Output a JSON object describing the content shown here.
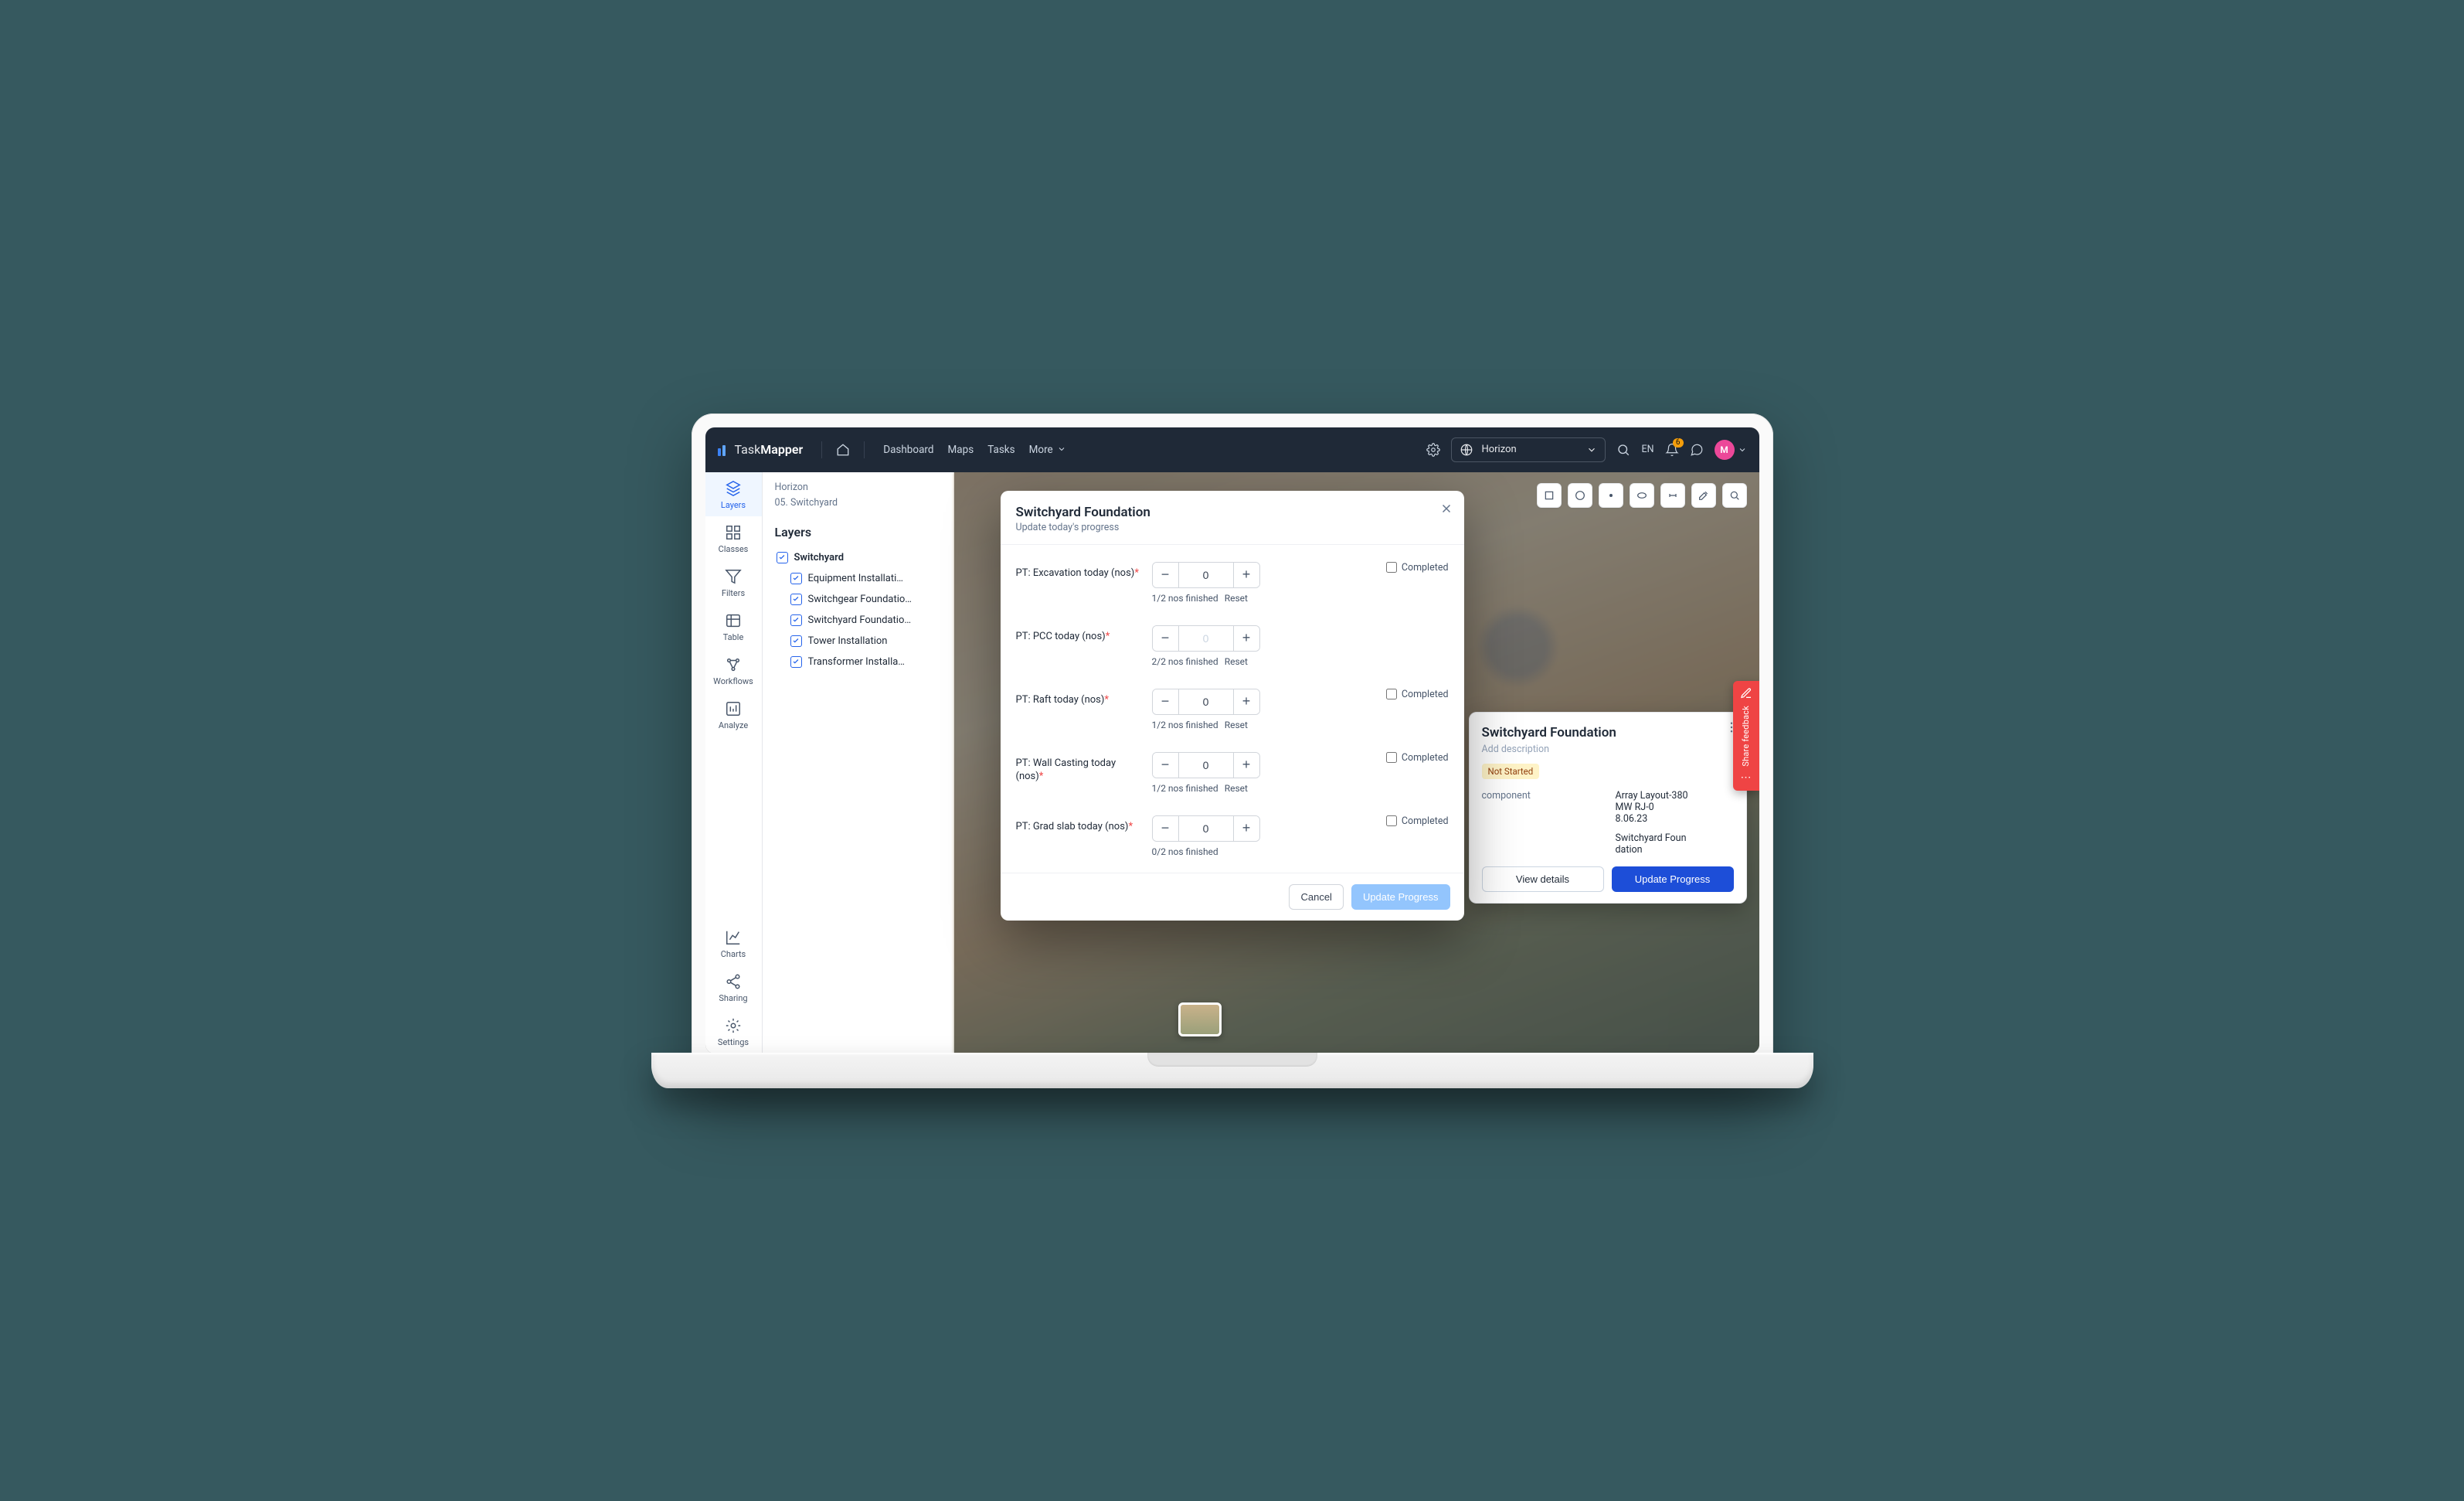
{
  "brand": {
    "name_prefix": "Task",
    "name_suffix": "Mapper"
  },
  "topnav": {
    "items": [
      "Dashboard",
      "Maps",
      "Tasks",
      "More"
    ],
    "asset_selected": "Horizon",
    "lang": "EN",
    "notif_count": "6",
    "avatar_letter": "M"
  },
  "rail": {
    "items_top": [
      "Layers",
      "Classes",
      "Filters",
      "Table",
      "Workflows",
      "Analyze"
    ],
    "items_bottom": [
      "Charts",
      "Sharing",
      "Settings"
    ],
    "active": "Layers"
  },
  "crumbs": {
    "line1": "Horizon",
    "line2": "05. Switchyard"
  },
  "panel": {
    "title": "Layers",
    "root": "Switchyard",
    "children": [
      "Equipment Installati…",
      "Switchgear Foundatio…",
      "Switchyard Foundatio…",
      "Tower Installation",
      "Transformer Installa…"
    ]
  },
  "modal": {
    "title": "Switchyard Foundation",
    "subtitle": "Update today's progress",
    "cancel": "Cancel",
    "submit": "Update Progress",
    "rows": [
      {
        "label": "PT: Excavation today (nos)",
        "value": "0",
        "helper": "1/2 nos finished",
        "reset": true,
        "completed": true,
        "dim": false
      },
      {
        "label": "PT: PCC today (nos)",
        "value": "0",
        "helper": "2/2 nos finished",
        "reset": true,
        "completed": false,
        "dim": true
      },
      {
        "label": "PT: Raft today (nos)",
        "value": "0",
        "helper": "1/2 nos finished",
        "reset": true,
        "completed": true,
        "dim": false
      },
      {
        "label": "PT: Wall Casting today (nos)",
        "value": "0",
        "helper": "1/2 nos finished",
        "reset": true,
        "completed": true,
        "dim": false
      },
      {
        "label": "PT: Grad slab today (nos)",
        "value": "0",
        "helper": "0/2 nos finished",
        "reset": false,
        "completed": true,
        "dim": false
      }
    ],
    "reset_label": "Reset",
    "completed_label": "Completed"
  },
  "card": {
    "title": "Switchyard Foundation",
    "desc": "Add description",
    "status": "Not Started",
    "col1_label": "component",
    "col2_line1": "Array Layout-380",
    "col2_line2": "MW  RJ-0",
    "col2_line3": "8.06.23",
    "col2_line4": "Switchyard Foun",
    "col2_line5": "dation",
    "view_details": "View details",
    "update": "Update Progress"
  },
  "feedback": {
    "label": "Share feedback"
  }
}
